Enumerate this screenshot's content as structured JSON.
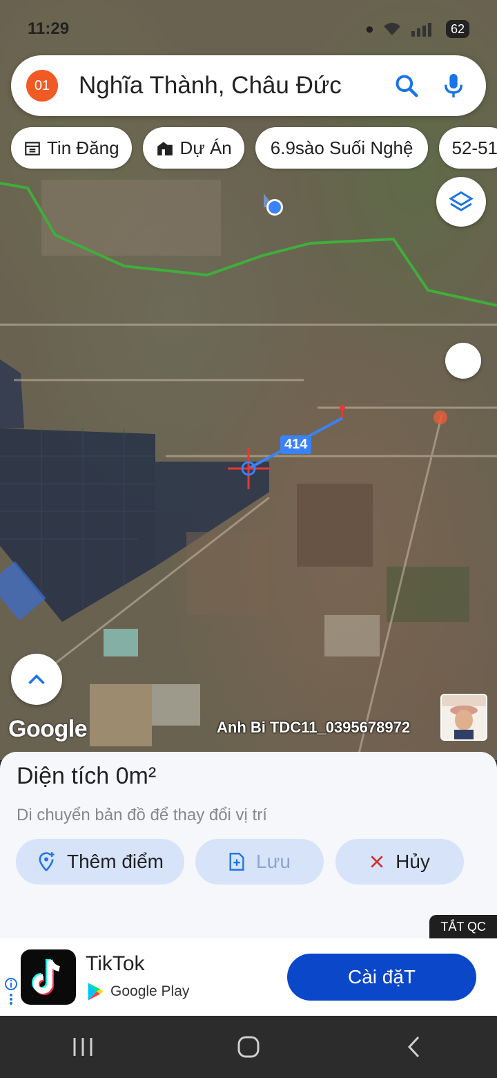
{
  "status": {
    "time": "11:29",
    "battery": "62"
  },
  "search": {
    "badge": "01",
    "query": "Nghĩa Thành, Châu Đức"
  },
  "chips": [
    {
      "label": "Tin Đăng",
      "icon": "calendar-icon"
    },
    {
      "label": "Dự Án",
      "icon": "building-icon"
    },
    {
      "label": "6.9sào Suối Nghệ",
      "icon": ""
    },
    {
      "label": "52-51",
      "icon": ""
    }
  ],
  "map": {
    "distance_label": "414",
    "attribution": "Google",
    "watermark": "Anh Bi TDC11_0395678972"
  },
  "panel": {
    "title": "Diện tích 0m²",
    "hint": "Di chuyển bản đồ để thay đổi vị trí",
    "add_point": "Thêm điểm",
    "save": "Lưu",
    "cancel": "Hủy"
  },
  "ad": {
    "close_label": "TẮT QC",
    "app_name": "TikTok",
    "store": "Google Play",
    "install": "Cài đặT"
  },
  "colors": {
    "accent_orange": "#f15a24",
    "button_blue": "#0b47c9",
    "chip_bg": "#d6e3f8",
    "route_green": "#3fae3a",
    "measure_blue": "#3b82f6"
  }
}
